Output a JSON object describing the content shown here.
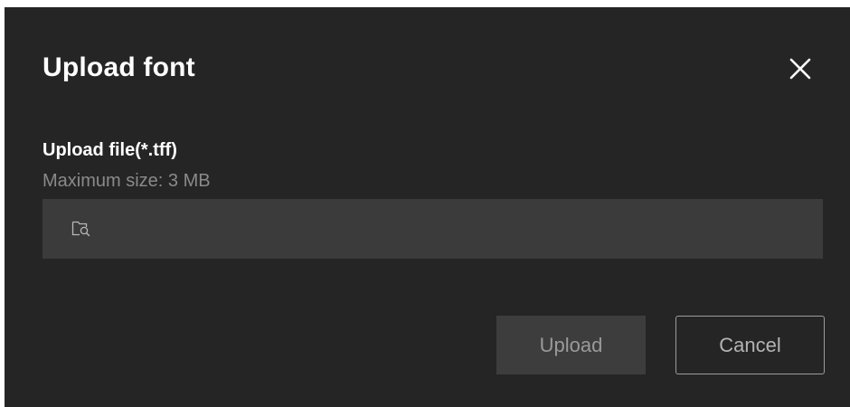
{
  "dialog": {
    "title": "Upload font",
    "close_icon": "close-icon",
    "field": {
      "label": "Upload file(*.tff)",
      "hint": "Maximum size: 3 MB",
      "picker_icon": "folder-search-icon",
      "value": ""
    },
    "buttons": {
      "upload_label": "Upload",
      "cancel_label": "Cancel"
    }
  },
  "colors": {
    "dialog_background": "#252525",
    "input_background": "#3b3b3b",
    "primary_disabled_background": "#3d3d3d",
    "title_text": "#ffffff",
    "hint_text": "#8a8a8a"
  }
}
